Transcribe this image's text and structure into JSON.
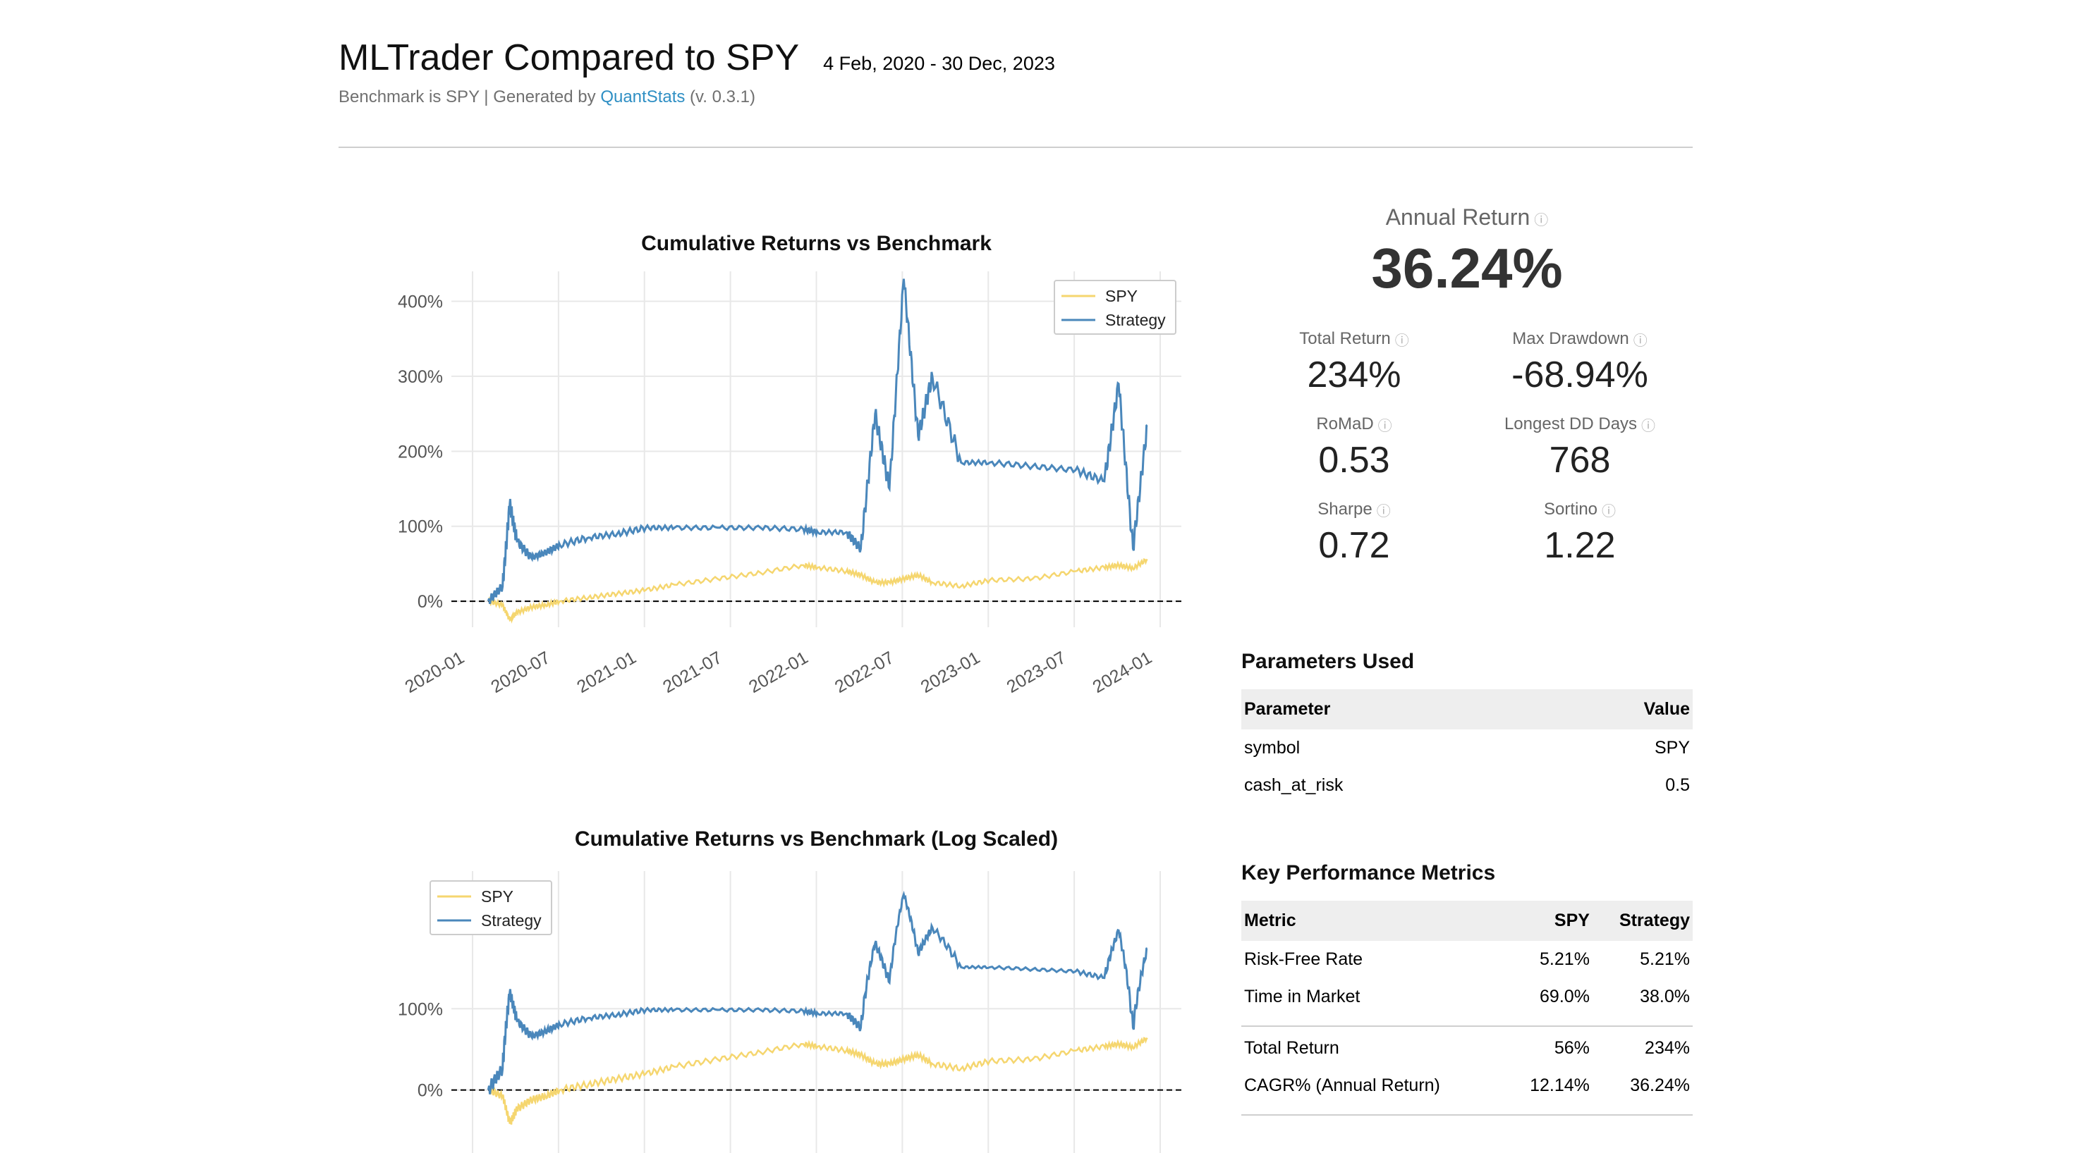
{
  "header": {
    "title": "MLTrader Compared to SPY",
    "date_range": "4 Feb, 2020 - 30 Dec, 2023",
    "subtitle_prefix": "Benchmark is SPY | Generated by ",
    "subtitle_link": "QuantStats",
    "subtitle_suffix": " (v. 0.3.1)"
  },
  "colors": {
    "spy": "#f5d66f",
    "strategy": "#4a87bb",
    "link": "#2f8fc4"
  },
  "summary": {
    "annual_return_label": "Annual Return",
    "annual_return_value": "36.24%",
    "kpis": [
      {
        "label": "Total Return",
        "value": "234%"
      },
      {
        "label": "Max Drawdown",
        "value": "-68.94%"
      },
      {
        "label": "RoMaD",
        "value": "0.53"
      },
      {
        "label": "Longest DD Days",
        "value": "768"
      },
      {
        "label": "Sharpe",
        "value": "0.72"
      },
      {
        "label": "Sortino",
        "value": "1.22"
      }
    ]
  },
  "parameters": {
    "title": "Parameters Used",
    "headers": [
      "Parameter",
      "Value"
    ],
    "rows": [
      [
        "symbol",
        "SPY"
      ],
      [
        "cash_at_risk",
        "0.5"
      ]
    ]
  },
  "metrics": {
    "title": "Key Performance Metrics",
    "headers": [
      "Metric",
      "SPY",
      "Strategy"
    ],
    "group1": [
      [
        "Risk-Free Rate",
        "5.21%",
        "5.21%"
      ],
      [
        "Time in Market",
        "69.0%",
        "38.0%"
      ]
    ],
    "group2": [
      [
        "Total Return",
        "56%",
        "234%"
      ],
      [
        "CAGR% (Annual Return)",
        "12.14%",
        "36.24%"
      ]
    ]
  },
  "chart_data": [
    {
      "type": "line",
      "title": "Cumulative Returns vs Benchmark",
      "xlabel": "",
      "ylabel": "",
      "x_ticks": [
        "2020-01",
        "2020-07",
        "2021-01",
        "2021-07",
        "2022-01",
        "2022-07",
        "2023-01",
        "2023-07",
        "2024-01"
      ],
      "y_ticks": [
        "0%",
        "100%",
        "200%",
        "300%",
        "400%"
      ],
      "ylim": [
        -30,
        440
      ],
      "legend": "top-right",
      "grid": true,
      "baseline": 0,
      "x": [
        "2020-02",
        "2020-03",
        "2020-03",
        "2020-04",
        "2020-05",
        "2020-06",
        "2020-07",
        "2020-09",
        "2020-11",
        "2021-01",
        "2021-03",
        "2021-06",
        "2021-09",
        "2021-12",
        "2022-01",
        "2022-03",
        "2022-04",
        "2022-05",
        "2022-06",
        "2022-07",
        "2022-08",
        "2022-09",
        "2022-11",
        "2023-01",
        "2023-04",
        "2023-07",
        "2023-09",
        "2023-10",
        "2023-11",
        "2023-12"
      ],
      "series": [
        {
          "name": "SPY",
          "values": [
            0,
            -5,
            -25,
            -15,
            -8,
            -5,
            0,
            5,
            10,
            15,
            22,
            30,
            38,
            48,
            45,
            40,
            35,
            25,
            25,
            30,
            35,
            25,
            20,
            28,
            30,
            40,
            45,
            48,
            44,
            56
          ]
        },
        {
          "name": "Strategy",
          "values": [
            0,
            20,
            130,
            80,
            58,
            65,
            75,
            85,
            90,
            98,
            98,
            98,
            98,
            96,
            92,
            92,
            70,
            250,
            150,
            430,
            220,
            300,
            185,
            185,
            180,
            175,
            160,
            290,
            70,
            235
          ]
        }
      ]
    },
    {
      "type": "line",
      "title": "Cumulative Returns vs Benchmark (Log Scaled)",
      "xlabel": "",
      "ylabel": "",
      "y_ticks": [
        "0%",
        "100%"
      ],
      "legend": "top-left",
      "grid": true,
      "log_scale": true,
      "baseline": 0,
      "x": [
        "2020-02",
        "2020-03",
        "2020-03",
        "2020-04",
        "2020-05",
        "2020-06",
        "2020-07",
        "2020-09",
        "2020-11",
        "2021-01",
        "2021-03",
        "2021-06",
        "2021-09",
        "2021-12",
        "2022-01",
        "2022-03",
        "2022-04",
        "2022-05",
        "2022-06",
        "2022-07",
        "2022-08",
        "2022-09",
        "2022-11",
        "2023-01",
        "2023-04",
        "2023-07",
        "2023-09",
        "2023-10",
        "2023-11",
        "2023-12"
      ],
      "series": [
        {
          "name": "SPY",
          "values": [
            0,
            -5,
            -25,
            -15,
            -8,
            -5,
            0,
            5,
            10,
            15,
            22,
            30,
            38,
            48,
            45,
            40,
            35,
            25,
            25,
            30,
            35,
            25,
            20,
            28,
            30,
            40,
            45,
            48,
            44,
            56
          ]
        },
        {
          "name": "Strategy",
          "values": [
            0,
            20,
            130,
            80,
            58,
            65,
            75,
            85,
            90,
            98,
            98,
            98,
            98,
            96,
            92,
            92,
            70,
            250,
            150,
            430,
            220,
            300,
            185,
            185,
            180,
            175,
            160,
            290,
            70,
            235
          ]
        }
      ]
    }
  ]
}
